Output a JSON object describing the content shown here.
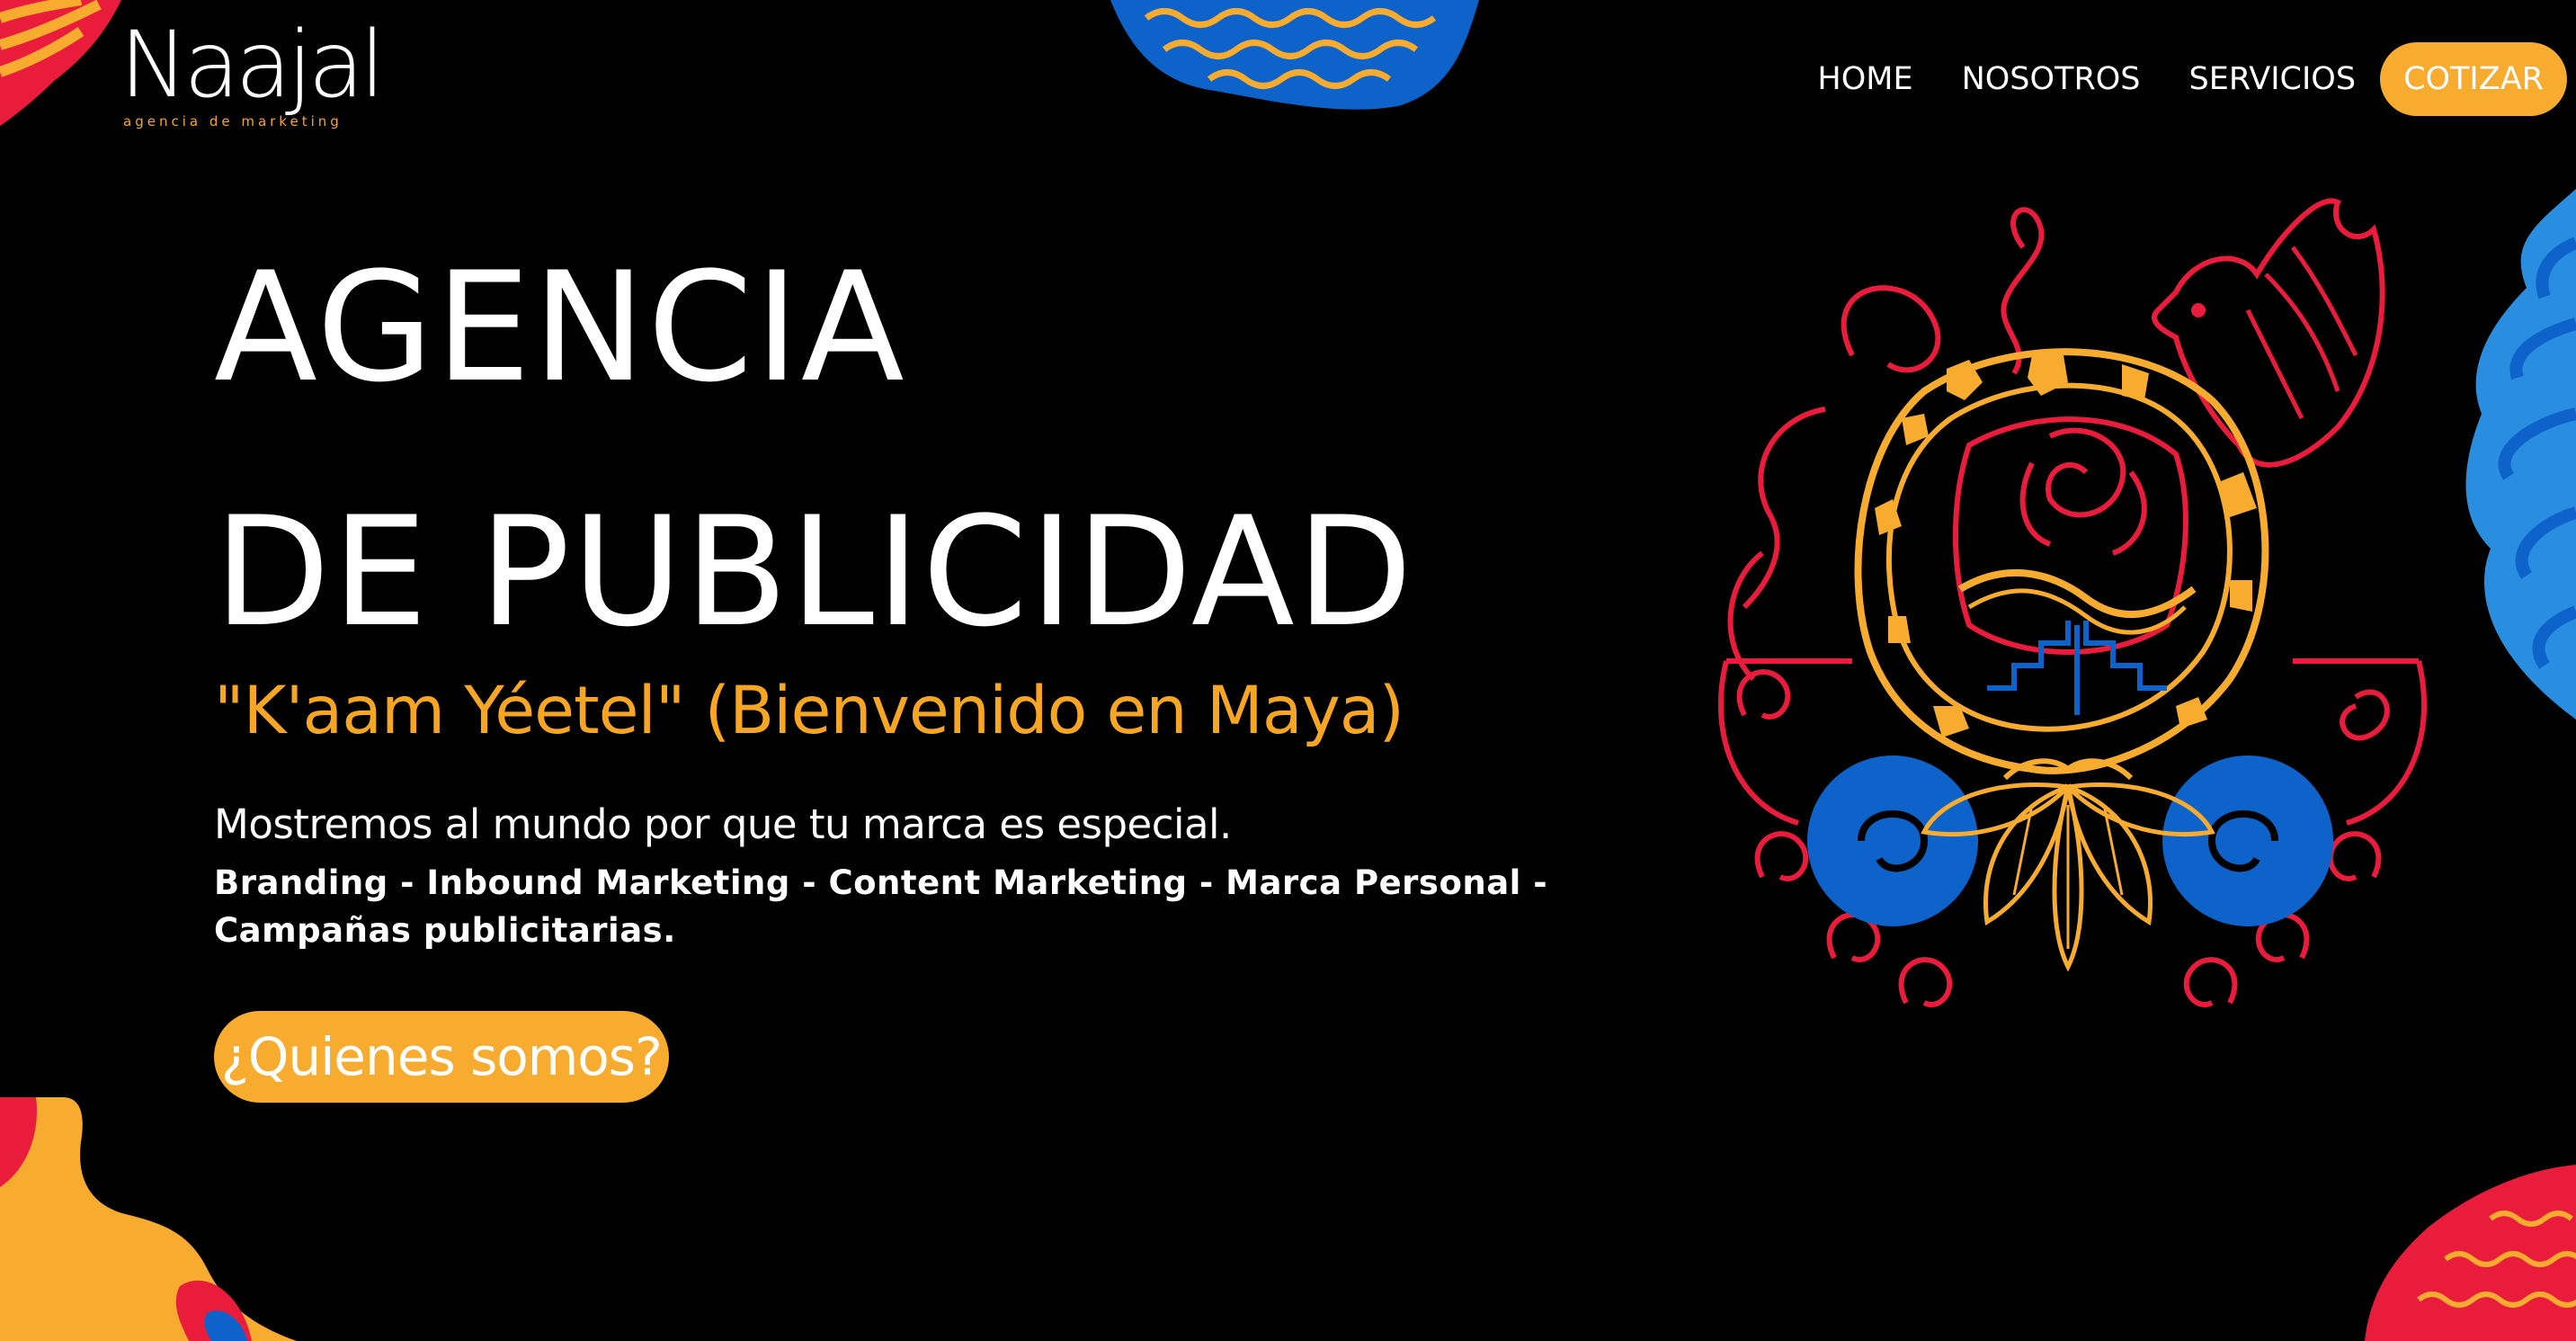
{
  "brand": {
    "name": "Naajal",
    "tagline": "agencia de marketing"
  },
  "nav": {
    "items": [
      {
        "label": "HOME"
      },
      {
        "label": "NOSOTROS"
      },
      {
        "label": "SERVICIOS"
      }
    ],
    "cta_label": "COTIZAR"
  },
  "hero": {
    "title_line1": "AGENCIA",
    "title_line2": "DE PUBLICIDAD",
    "subtitle": "\"K'aam Yéetel\" (Bienvenido en Maya)",
    "lead": "Mostremos al mundo por que tu marca es especial.",
    "services": "Branding - Inbound Marketing - Content Marketing - Marca Personal - Campañas publicitarias.",
    "button_label": "¿Quienes somos?"
  },
  "colors": {
    "background": "#000000",
    "accent": "#f7ab2f",
    "red": "#ea1c3c",
    "blue": "#0d63c9"
  },
  "icons": {
    "hero_art": "maya-glyph-icon",
    "decorations": "pattern-blob-icon"
  }
}
